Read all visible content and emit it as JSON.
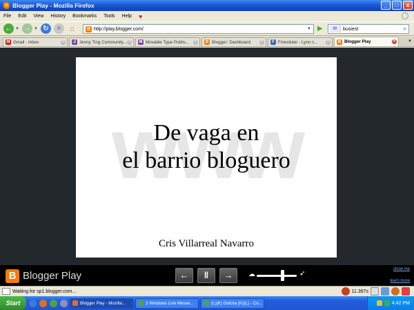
{
  "window": {
    "title": "Blogger Play - Mozilla Firefox",
    "min": "_",
    "max": "□",
    "close": "x"
  },
  "menu": [
    "File",
    "Edit",
    "View",
    "History",
    "Bookmarks",
    "Tools",
    "Help"
  ],
  "nav": {
    "url": "http://play.blogger.com/",
    "search": "busiest"
  },
  "tabs": [
    {
      "label": "Gmail - Inbox",
      "color": "#cc2222",
      "icon": "M"
    },
    {
      "label": "Jenny Ting Community...",
      "color": "#7a4a9a",
      "icon": "J"
    },
    {
      "label": "Movable Type Publis...",
      "color": "#7a4a9a",
      "icon": "M"
    },
    {
      "label": "Blogger: Dashboard",
      "color": "#f57d00",
      "icon": "B"
    },
    {
      "label": "Friendster - Lynn c...",
      "color": "#3a6ab0",
      "icon": "F"
    },
    {
      "label": "Blogger Play",
      "color": "#f57d00",
      "icon": "B",
      "active": true
    }
  ],
  "slide": {
    "watermark": "www",
    "title_line1": "De vaga en",
    "title_line2": "el barrio bloguero",
    "author": "Cris Villarreal Navarro"
  },
  "player": {
    "logo": "B",
    "name": "Blogger Play",
    "prev": "←",
    "pause": "‖",
    "next": "→",
    "speed_level": 0.65,
    "link_top": "show me",
    "link_bottom": "learn more"
  },
  "status": {
    "text": "Waiting for sp1.blogger.com...",
    "zoom": "11.397s"
  },
  "taskbar": {
    "start": "Start",
    "buttons": [
      {
        "label": "Blogger Play - Mozilla...",
        "active": true
      },
      {
        "label": "2 Windows Live Messe...",
        "active": false
      },
      {
        "label": "(L)(K) Dolcita (K)(L) - Co...",
        "active": false
      }
    ],
    "clock": "4:42 PM"
  }
}
